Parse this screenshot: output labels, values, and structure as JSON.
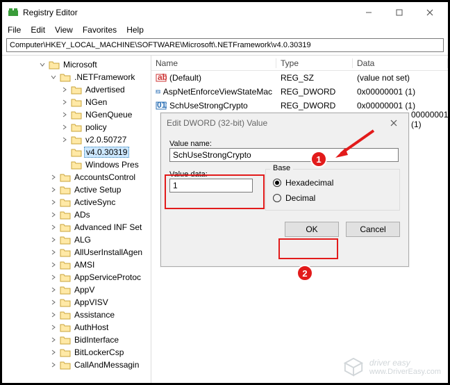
{
  "window": {
    "title": "Registry Editor"
  },
  "menu": {
    "file": "File",
    "edit": "Edit",
    "view": "View",
    "favorites": "Favorites",
    "help": "Help"
  },
  "address": "Computer\\HKEY_LOCAL_MACHINE\\SOFTWARE\\Microsoft\\.NETFramework\\v4.0.30319",
  "tree": {
    "root": "Microsoft",
    "netfw": ".NETFramework",
    "children": [
      "Advertised",
      "NGen",
      "NGenQueue",
      "policy",
      "v2.0.50727",
      "v4.0.30319",
      "Windows Pres"
    ],
    "siblings": [
      "AccountsControl",
      "Active Setup",
      "ActiveSync",
      "ADs",
      "Advanced INF Set",
      "ALG",
      "AllUserInstallAgen",
      "AMSI",
      "AppServiceProtoc",
      "AppV",
      "AppVISV",
      "Assistance",
      "AuthHost",
      "BidInterface",
      "BitLockerCsp",
      "CallAndMessagin"
    ]
  },
  "list": {
    "headers": {
      "name": "Name",
      "type": "Type",
      "data": "Data"
    },
    "rows": [
      {
        "name": "(Default)",
        "type": "REG_SZ",
        "data": "(value not set)",
        "kind": "sz"
      },
      {
        "name": "AspNetEnforceViewStateMac",
        "type": "REG_DWORD",
        "data": "0x00000001 (1)",
        "kind": "dw"
      },
      {
        "name": "SchUseStrongCrypto",
        "type": "REG_DWORD",
        "data": "0x00000001 (1)",
        "kind": "dw"
      }
    ],
    "extra_data_tail": "00000001 (1)"
  },
  "dialog": {
    "title": "Edit DWORD (32-bit) Value",
    "value_name_label": "Value name:",
    "value_name": "SchUseStrongCrypto",
    "value_data_label": "Value data:",
    "value_data": "1",
    "base_label": "Base",
    "hex_label": "Hexadecimal",
    "dec_label": "Decimal",
    "base": "hex",
    "ok": "OK",
    "cancel": "Cancel"
  },
  "annotations": {
    "step1": "1",
    "step2": "2"
  },
  "watermark": {
    "brand": "driver easy",
    "url": "www.DriverEasy.com"
  }
}
